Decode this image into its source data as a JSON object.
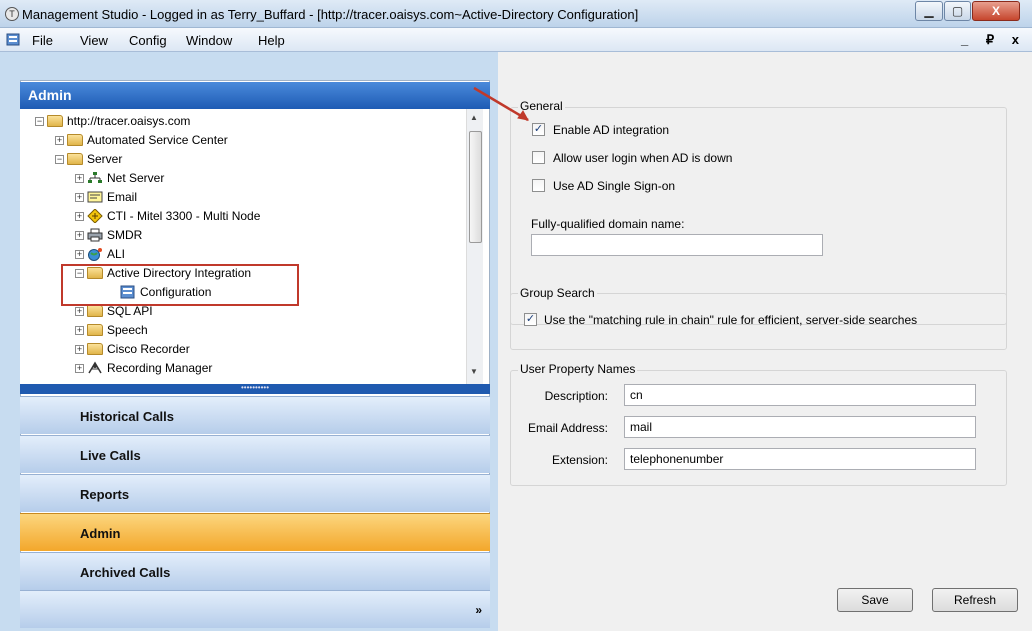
{
  "window": {
    "title": "Management Studio - Logged in as Terry_Buffard - [http://tracer.oaisys.com~Active-Directory Configuration]",
    "controls": {
      "minimize": "▁",
      "maximize": "▢",
      "close": "X"
    }
  },
  "menubar": {
    "items": [
      "File",
      "View",
      "Config",
      "Window",
      "Help"
    ],
    "mdi_controls": "_ ₽ x"
  },
  "admin_panel": {
    "header": "Admin",
    "tree": [
      {
        "label": "http://tracer.oaisys.com",
        "icon": "folder-icon",
        "expander": "−"
      },
      {
        "label": "Automated Service Center",
        "icon": "folder-icon",
        "expander": "+"
      },
      {
        "label": "Server",
        "icon": "folder-icon",
        "expander": "−"
      },
      {
        "label": "Net Server",
        "icon": "network-icon",
        "expander": "+"
      },
      {
        "label": "Email",
        "icon": "email-icon",
        "expander": "+"
      },
      {
        "label": "CTI - Mitel 3300 - Multi Node",
        "icon": "cti-icon",
        "expander": "+"
      },
      {
        "label": "SMDR",
        "icon": "printer-icon",
        "expander": "+"
      },
      {
        "label": "ALI",
        "icon": "globe-icon",
        "expander": "+"
      },
      {
        "label": "Active Directory Integration",
        "icon": "folder-icon",
        "expander": "−"
      },
      {
        "label": "Configuration",
        "icon": "config-icon",
        "expander": ""
      },
      {
        "label": "SQL API",
        "icon": "folder-icon",
        "expander": "+"
      },
      {
        "label": "Speech",
        "icon": "folder-icon",
        "expander": "+"
      },
      {
        "label": "Cisco Recorder",
        "icon": "folder-icon",
        "expander": "+"
      },
      {
        "label": "Recording Manager",
        "icon": "recording-manager-icon",
        "expander": "+"
      }
    ],
    "splitter_grip": "••••••••••"
  },
  "nav": {
    "items": [
      "Historical Calls",
      "Live Calls",
      "Reports",
      "Admin",
      "Archived Calls"
    ],
    "active": "Admin",
    "overflow": "»"
  },
  "config": {
    "general": {
      "legend": "General",
      "enable_ad": {
        "label": "Enable AD integration",
        "checked": true
      },
      "allow_login": {
        "label": "Allow user login when AD is down",
        "checked": false
      },
      "single_sign_on": {
        "label": "Use AD Single Sign-on",
        "checked": false
      },
      "fqdn_label": "Fully-qualified domain name:",
      "fqdn_value": ""
    },
    "group_search": {
      "legend": "Group Search",
      "matching_rule": {
        "label": "Use the \"matching rule in chain\" rule for efficient, server-side searches",
        "checked": true
      }
    },
    "user_props": {
      "legend": "User Property Names",
      "description_label": "Description:",
      "description_value": "cn",
      "email_label": "Email Address:",
      "email_value": "mail",
      "extension_label": "Extension:",
      "extension_value": "telephonenumber"
    },
    "save_label": "Save",
    "refresh_label": "Refresh"
  },
  "colors": {
    "annotation": "#c0392b",
    "active_nav": "#f3a72b",
    "header_blue": "#1e5bb4"
  }
}
